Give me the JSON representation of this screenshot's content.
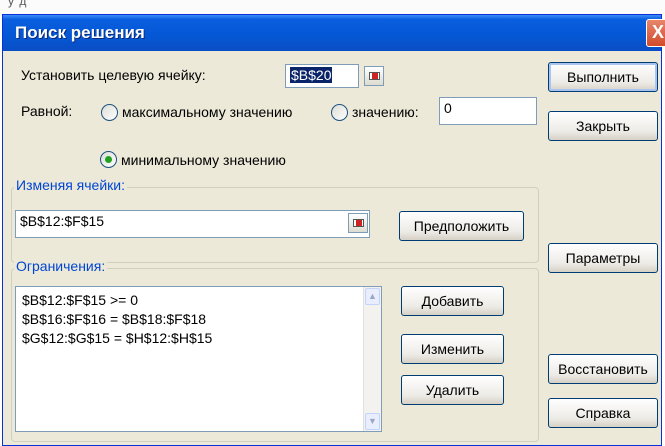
{
  "window": {
    "title": "Поиск решения",
    "close_glyph": "X"
  },
  "page_fragment": "у д",
  "target": {
    "label_prefix": "Установить целевую ячейку:",
    "value": "$B$20"
  },
  "equal": {
    "label": "Равной:",
    "options": [
      {
        "label": "максимальному значению",
        "selected": false
      },
      {
        "label": "значению:",
        "selected": false
      },
      {
        "label": "минимальному значению",
        "selected": true
      }
    ],
    "value_field": "0"
  },
  "changing": {
    "group_label": "Изменяя ячейки:",
    "value": "$B$12:$F$15",
    "guess_button": "Предположить"
  },
  "constraints": {
    "group_label": "Ограничения:",
    "items": [
      "$B$12:$F$15 >= 0",
      "$B$16:$F$16 = $B$18:$F$18",
      "$G$12:$G$15 = $H$12:$H$15"
    ],
    "add_button": "Добавить",
    "change_button": "Изменить",
    "delete_button": "Удалить"
  },
  "side_buttons": {
    "run": "Выполнить",
    "close": "Закрыть",
    "options": "Параметры",
    "restore": "Восстановить",
    "help": "Справка"
  }
}
